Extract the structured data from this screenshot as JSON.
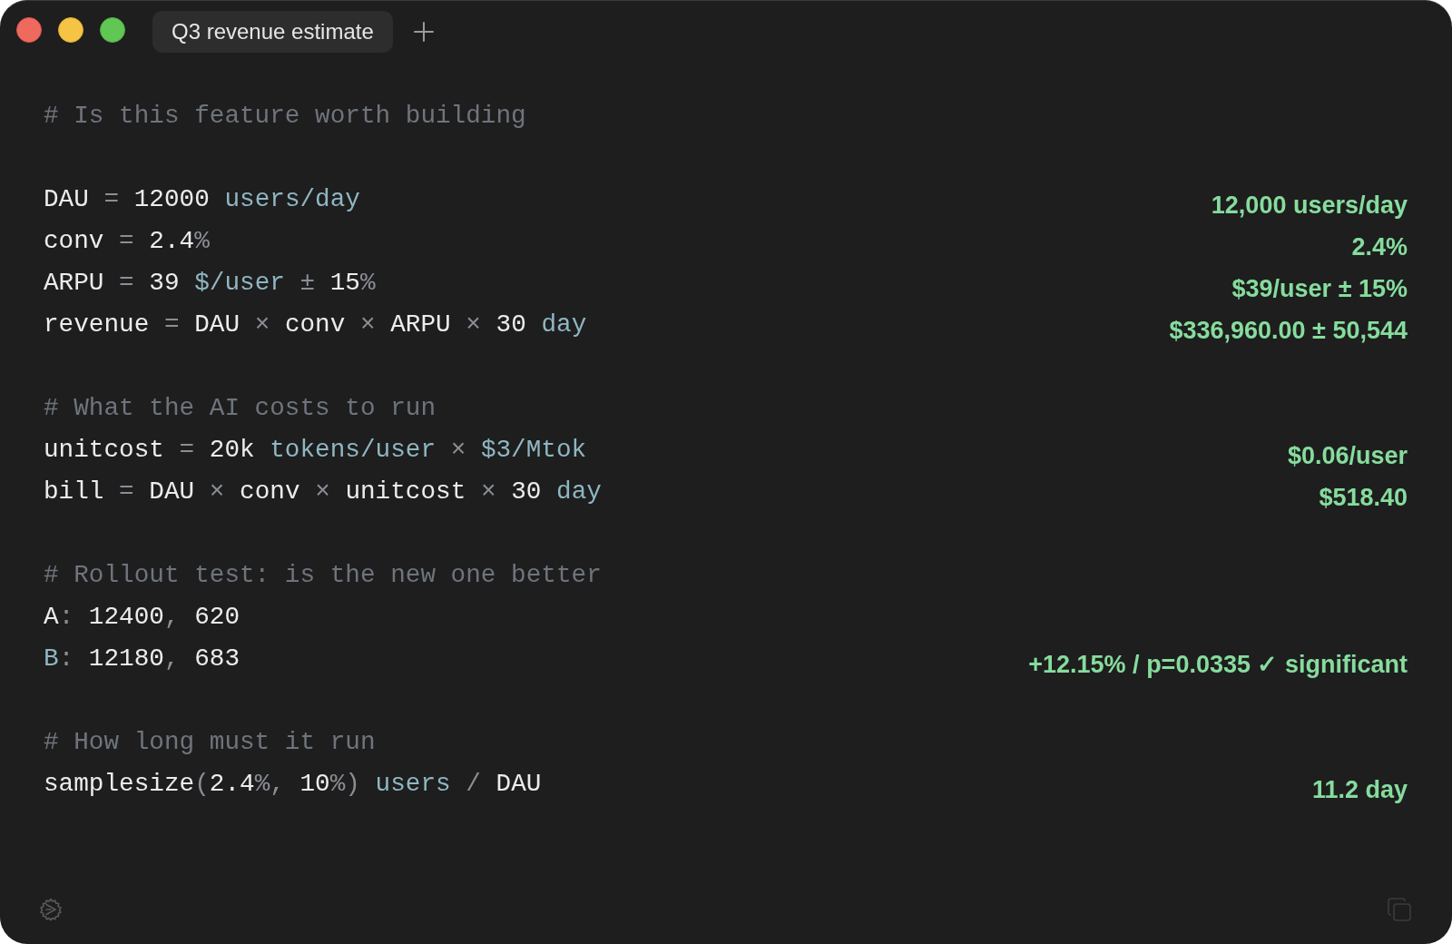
{
  "window": {
    "tabs": [
      {
        "label": "Q3 revenue estimate",
        "selected": true
      }
    ]
  },
  "lines": [
    {
      "kind": "comment",
      "text": "# Is this feature worth building"
    },
    {
      "kind": "blank"
    },
    {
      "kind": "code",
      "tokens": [
        {
          "kind": "plain",
          "text": "DAU"
        },
        {
          "kind": "punct",
          "text": " = "
        },
        {
          "kind": "plain",
          "text": "12000 "
        },
        {
          "kind": "unit",
          "text": "users/day"
        }
      ],
      "result": "12,000 users/day"
    },
    {
      "kind": "code",
      "tokens": [
        {
          "kind": "plain",
          "text": "conv"
        },
        {
          "kind": "punct",
          "text": " = "
        },
        {
          "kind": "plain",
          "text": "2.4"
        },
        {
          "kind": "punct",
          "text": "%"
        }
      ],
      "result": "2.4%"
    },
    {
      "kind": "code",
      "tokens": [
        {
          "kind": "plain",
          "text": "ARPU"
        },
        {
          "kind": "punct",
          "text": " = "
        },
        {
          "kind": "plain",
          "text": "39 "
        },
        {
          "kind": "unit",
          "text": "$/user"
        },
        {
          "kind": "punct",
          "text": " ± "
        },
        {
          "kind": "plain",
          "text": "15"
        },
        {
          "kind": "punct",
          "text": "%"
        }
      ],
      "result": "$39/user ± 15%"
    },
    {
      "kind": "code",
      "tokens": [
        {
          "kind": "plain",
          "text": "revenue"
        },
        {
          "kind": "punct",
          "text": " = "
        },
        {
          "kind": "plain",
          "text": "DAU"
        },
        {
          "kind": "punct",
          "text": " × "
        },
        {
          "kind": "plain",
          "text": "conv"
        },
        {
          "kind": "punct",
          "text": " × "
        },
        {
          "kind": "plain",
          "text": "ARPU"
        },
        {
          "kind": "punct",
          "text": " × "
        },
        {
          "kind": "plain",
          "text": "30 "
        },
        {
          "kind": "unit",
          "text": "day"
        }
      ],
      "result": "$336,960.00 ± 50,544"
    },
    {
      "kind": "blank"
    },
    {
      "kind": "comment",
      "text": "# What the AI costs to run"
    },
    {
      "kind": "code",
      "tokens": [
        {
          "kind": "plain",
          "text": "unitcost"
        },
        {
          "kind": "punct",
          "text": " = "
        },
        {
          "kind": "plain",
          "text": "20k "
        },
        {
          "kind": "unit",
          "text": "tokens/user"
        },
        {
          "kind": "punct",
          "text": " × "
        },
        {
          "kind": "unit",
          "text": "$3/Mtok"
        }
      ],
      "result": "$0.06/user"
    },
    {
      "kind": "code",
      "tokens": [
        {
          "kind": "plain",
          "text": "bill"
        },
        {
          "kind": "punct",
          "text": " = "
        },
        {
          "kind": "plain",
          "text": "DAU"
        },
        {
          "kind": "punct",
          "text": " × "
        },
        {
          "kind": "plain",
          "text": "conv"
        },
        {
          "kind": "punct",
          "text": " × "
        },
        {
          "kind": "plain",
          "text": "unitcost"
        },
        {
          "kind": "punct",
          "text": " × "
        },
        {
          "kind": "plain",
          "text": "30 "
        },
        {
          "kind": "unit",
          "text": "day"
        }
      ],
      "result": "$518.40"
    },
    {
      "kind": "blank"
    },
    {
      "kind": "comment",
      "text": "# Rollout test: is the new one better"
    },
    {
      "kind": "code",
      "tokens": [
        {
          "kind": "plain",
          "text": "A"
        },
        {
          "kind": "punct",
          "text": ": "
        },
        {
          "kind": "plain",
          "text": "12400"
        },
        {
          "kind": "punct",
          "text": ", "
        },
        {
          "kind": "plain",
          "text": "620"
        }
      ]
    },
    {
      "kind": "code",
      "tokens": [
        {
          "kind": "unit",
          "text": "B"
        },
        {
          "kind": "punct",
          "text": ": "
        },
        {
          "kind": "plain",
          "text": "12180"
        },
        {
          "kind": "punct",
          "text": ", "
        },
        {
          "kind": "plain",
          "text": "683"
        }
      ],
      "result": "+12.15% / p=0.0335 ✓ significant"
    },
    {
      "kind": "blank"
    },
    {
      "kind": "comment",
      "text": "# How long must it run"
    },
    {
      "kind": "code",
      "tokens": [
        {
          "kind": "plain",
          "text": "samplesize"
        },
        {
          "kind": "punct",
          "text": "("
        },
        {
          "kind": "plain",
          "text": "2.4"
        },
        {
          "kind": "punct",
          "text": "%, "
        },
        {
          "kind": "plain",
          "text": "10"
        },
        {
          "kind": "punct",
          "text": "%) "
        },
        {
          "kind": "unit",
          "text": "users"
        },
        {
          "kind": "punct",
          "text": " / "
        },
        {
          "kind": "plain",
          "text": "DAU"
        }
      ],
      "result": "11.2 day"
    }
  ]
}
